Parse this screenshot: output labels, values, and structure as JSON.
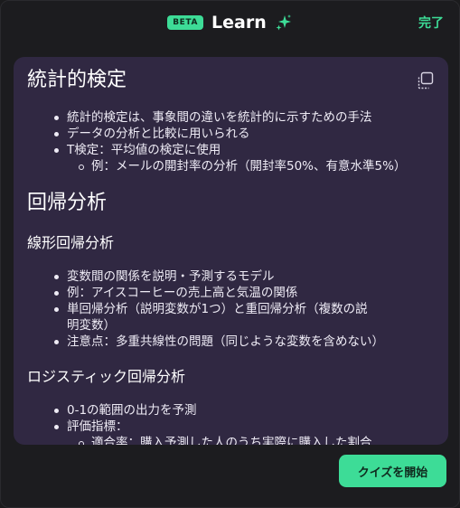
{
  "header": {
    "badge": "BETA",
    "title": "Learn",
    "done_label": "完了"
  },
  "content": {
    "section1": {
      "title": "統計的検定",
      "items": [
        "統計的検定は、事象間の違いを統計的に示すための手法",
        "データの分析と比較に用いられる",
        "T検定：平均値の検定に使用"
      ],
      "subitems": [
        "例：メールの開封率の分析（開封率50%、有意水準5%）"
      ]
    },
    "section2": {
      "title": "回帰分析",
      "sub1": {
        "title": "線形回帰分析",
        "items": [
          "変数間の関係を説明・予測するモデル",
          "例：アイスコーヒーの売上高と気温の関係",
          "単回帰分析（説明変数が1つ）と重回帰分析（複数の説明変数）",
          "注意点：多重共線性の問題（同じような変数を含めない）"
        ]
      },
      "sub2": {
        "title": "ロジスティック回帰分析",
        "items": [
          "0-1の範囲の出力を予測",
          "評価指標："
        ],
        "subitems": [
          "適合率：購入予測した人のうち実際に購入した割合"
        ]
      }
    }
  },
  "footer": {
    "start_label": "クイズを開始"
  },
  "colors": {
    "accent": "#3ddc97",
    "card_bg": "#302842",
    "window_bg": "#1c1c1f"
  }
}
